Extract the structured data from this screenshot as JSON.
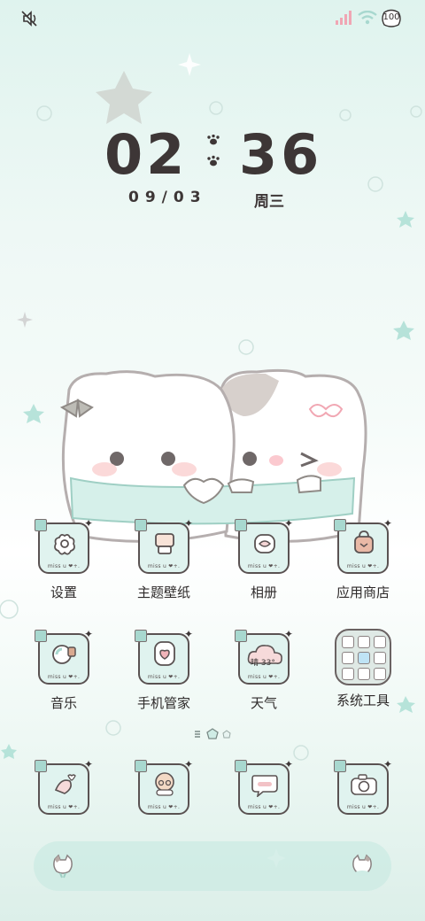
{
  "status_bar": {
    "battery": "100",
    "icons": [
      "mute-icon",
      "signal-icon",
      "wifi-icon",
      "battery-icon"
    ]
  },
  "clock": {
    "hours": "02",
    "minutes": "36",
    "date": "09/03",
    "weekday": "周三"
  },
  "apps_row1": [
    {
      "label": "设置",
      "icon": "settings-icon"
    },
    {
      "label": "主题壁纸",
      "icon": "theme-icon"
    },
    {
      "label": "相册",
      "icon": "gallery-icon"
    },
    {
      "label": "应用商店",
      "icon": "store-icon"
    }
  ],
  "apps_row2": [
    {
      "label": "音乐",
      "icon": "music-icon"
    },
    {
      "label": "手机管家",
      "icon": "phone-manager-icon"
    },
    {
      "label": "天气",
      "icon": "weather-icon",
      "weather_text": "晴 33°"
    },
    {
      "label": "系统工具",
      "icon": "folder-icon"
    }
  ],
  "icon_signature": "miss u ❤+.",
  "dock": [
    "sticker-icon-left",
    "sticker-icon-right"
  ],
  "colors": {
    "mint": "#e0f3ef",
    "outline": "#5a5252",
    "text": "#2e2a2a"
  }
}
